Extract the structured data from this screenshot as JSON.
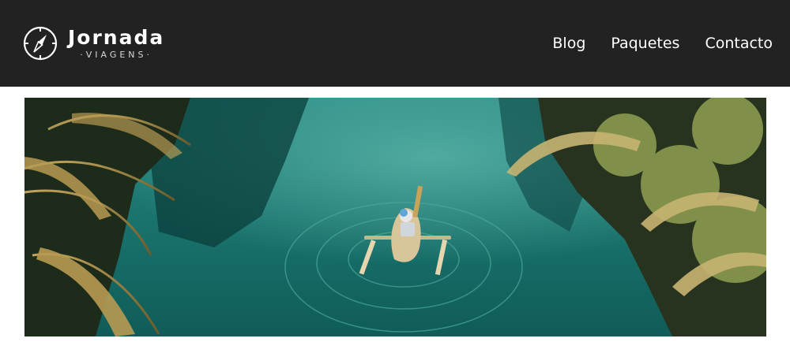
{
  "header": {
    "brand": "Jornada",
    "tagline": "·VIAGENS·",
    "logo_icon": "compass-icon",
    "background": "#222222"
  },
  "nav": {
    "items": [
      {
        "label": "Blog"
      },
      {
        "label": "Paquetes"
      },
      {
        "label": "Contacto"
      }
    ]
  },
  "hero": {
    "image": "river-canoe-photo"
  }
}
